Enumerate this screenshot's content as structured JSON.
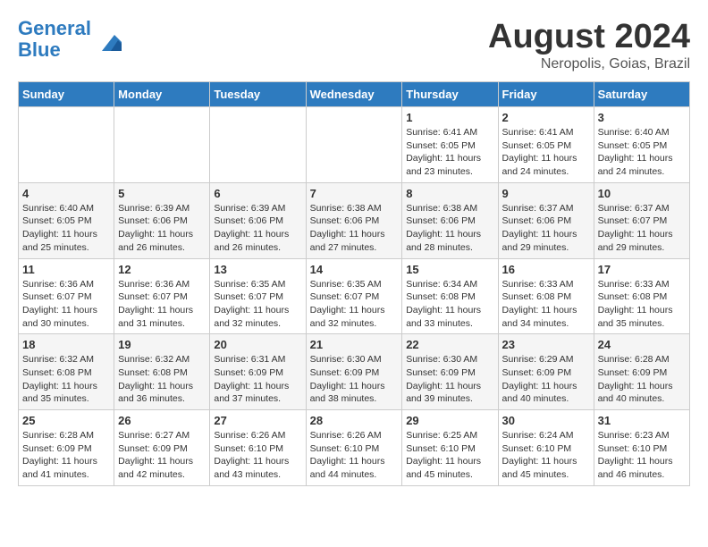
{
  "logo": {
    "line1": "General",
    "line2": "Blue"
  },
  "title": "August 2024",
  "location": "Neropolis, Goias, Brazil",
  "weekdays": [
    "Sunday",
    "Monday",
    "Tuesday",
    "Wednesday",
    "Thursday",
    "Friday",
    "Saturday"
  ],
  "weeks": [
    [
      {
        "day": "",
        "info": ""
      },
      {
        "day": "",
        "info": ""
      },
      {
        "day": "",
        "info": ""
      },
      {
        "day": "",
        "info": ""
      },
      {
        "day": "1",
        "info": "Sunrise: 6:41 AM\nSunset: 6:05 PM\nDaylight: 11 hours and 23 minutes."
      },
      {
        "day": "2",
        "info": "Sunrise: 6:41 AM\nSunset: 6:05 PM\nDaylight: 11 hours and 24 minutes."
      },
      {
        "day": "3",
        "info": "Sunrise: 6:40 AM\nSunset: 6:05 PM\nDaylight: 11 hours and 24 minutes."
      }
    ],
    [
      {
        "day": "4",
        "info": "Sunrise: 6:40 AM\nSunset: 6:05 PM\nDaylight: 11 hours and 25 minutes."
      },
      {
        "day": "5",
        "info": "Sunrise: 6:39 AM\nSunset: 6:06 PM\nDaylight: 11 hours and 26 minutes."
      },
      {
        "day": "6",
        "info": "Sunrise: 6:39 AM\nSunset: 6:06 PM\nDaylight: 11 hours and 26 minutes."
      },
      {
        "day": "7",
        "info": "Sunrise: 6:38 AM\nSunset: 6:06 PM\nDaylight: 11 hours and 27 minutes."
      },
      {
        "day": "8",
        "info": "Sunrise: 6:38 AM\nSunset: 6:06 PM\nDaylight: 11 hours and 28 minutes."
      },
      {
        "day": "9",
        "info": "Sunrise: 6:37 AM\nSunset: 6:06 PM\nDaylight: 11 hours and 29 minutes."
      },
      {
        "day": "10",
        "info": "Sunrise: 6:37 AM\nSunset: 6:07 PM\nDaylight: 11 hours and 29 minutes."
      }
    ],
    [
      {
        "day": "11",
        "info": "Sunrise: 6:36 AM\nSunset: 6:07 PM\nDaylight: 11 hours and 30 minutes."
      },
      {
        "day": "12",
        "info": "Sunrise: 6:36 AM\nSunset: 6:07 PM\nDaylight: 11 hours and 31 minutes."
      },
      {
        "day": "13",
        "info": "Sunrise: 6:35 AM\nSunset: 6:07 PM\nDaylight: 11 hours and 32 minutes."
      },
      {
        "day": "14",
        "info": "Sunrise: 6:35 AM\nSunset: 6:07 PM\nDaylight: 11 hours and 32 minutes."
      },
      {
        "day": "15",
        "info": "Sunrise: 6:34 AM\nSunset: 6:08 PM\nDaylight: 11 hours and 33 minutes."
      },
      {
        "day": "16",
        "info": "Sunrise: 6:33 AM\nSunset: 6:08 PM\nDaylight: 11 hours and 34 minutes."
      },
      {
        "day": "17",
        "info": "Sunrise: 6:33 AM\nSunset: 6:08 PM\nDaylight: 11 hours and 35 minutes."
      }
    ],
    [
      {
        "day": "18",
        "info": "Sunrise: 6:32 AM\nSunset: 6:08 PM\nDaylight: 11 hours and 35 minutes."
      },
      {
        "day": "19",
        "info": "Sunrise: 6:32 AM\nSunset: 6:08 PM\nDaylight: 11 hours and 36 minutes."
      },
      {
        "day": "20",
        "info": "Sunrise: 6:31 AM\nSunset: 6:09 PM\nDaylight: 11 hours and 37 minutes."
      },
      {
        "day": "21",
        "info": "Sunrise: 6:30 AM\nSunset: 6:09 PM\nDaylight: 11 hours and 38 minutes."
      },
      {
        "day": "22",
        "info": "Sunrise: 6:30 AM\nSunset: 6:09 PM\nDaylight: 11 hours and 39 minutes."
      },
      {
        "day": "23",
        "info": "Sunrise: 6:29 AM\nSunset: 6:09 PM\nDaylight: 11 hours and 40 minutes."
      },
      {
        "day": "24",
        "info": "Sunrise: 6:28 AM\nSunset: 6:09 PM\nDaylight: 11 hours and 40 minutes."
      }
    ],
    [
      {
        "day": "25",
        "info": "Sunrise: 6:28 AM\nSunset: 6:09 PM\nDaylight: 11 hours and 41 minutes."
      },
      {
        "day": "26",
        "info": "Sunrise: 6:27 AM\nSunset: 6:09 PM\nDaylight: 11 hours and 42 minutes."
      },
      {
        "day": "27",
        "info": "Sunrise: 6:26 AM\nSunset: 6:10 PM\nDaylight: 11 hours and 43 minutes."
      },
      {
        "day": "28",
        "info": "Sunrise: 6:26 AM\nSunset: 6:10 PM\nDaylight: 11 hours and 44 minutes."
      },
      {
        "day": "29",
        "info": "Sunrise: 6:25 AM\nSunset: 6:10 PM\nDaylight: 11 hours and 45 minutes."
      },
      {
        "day": "30",
        "info": "Sunrise: 6:24 AM\nSunset: 6:10 PM\nDaylight: 11 hours and 45 minutes."
      },
      {
        "day": "31",
        "info": "Sunrise: 6:23 AM\nSunset: 6:10 PM\nDaylight: 11 hours and 46 minutes."
      }
    ]
  ]
}
